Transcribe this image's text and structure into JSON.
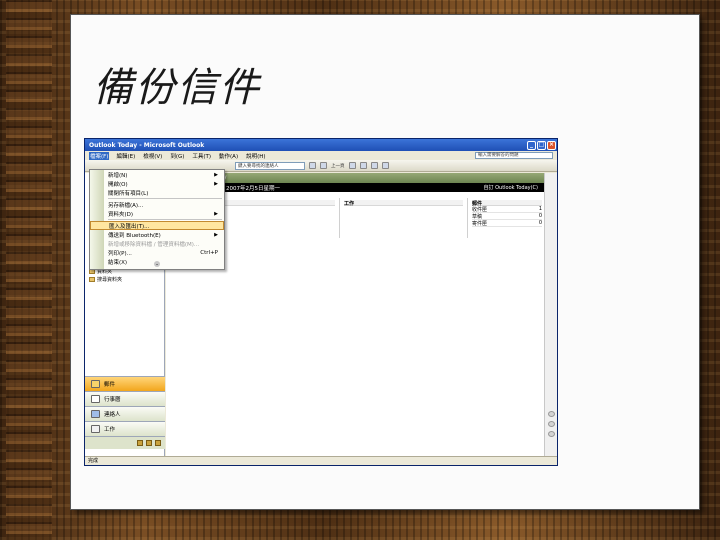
{
  "slide": {
    "title": "備份信件"
  },
  "window": {
    "title": "Outlook Today - Microsoft Outlook",
    "buttons": [
      "_",
      "□",
      "×"
    ]
  },
  "menubar": {
    "items": [
      "檔案(F)",
      "編輯(E)",
      "檢視(V)",
      "到(G)",
      "工具(T)",
      "動作(A)",
      "說明(H)"
    ],
    "help_placeholder": "輸入需要解答的問題"
  },
  "toolbar": {
    "address": "鍵入要尋找的連絡人",
    "back_label": "上一頁",
    "forward_label": ""
  },
  "file_menu": {
    "items": [
      {
        "label": "新增(N)",
        "submenu": true
      },
      {
        "label": "開啟(O)",
        "submenu": true
      },
      {
        "label": "關閉所有項目(L)",
        "submenu": false
      },
      {
        "label": "另存新檔(A)...",
        "submenu": false
      },
      {
        "label": "資料夾(D)",
        "submenu": true
      },
      {
        "label": "匯入及匯出(T)...",
        "submenu": false,
        "highlight": true
      },
      {
        "label": "傳送到 Bluetooth(E)",
        "submenu": true
      },
      {
        "label": "新增或移除資料檔 / 管理資料檔(M)...",
        "submenu": false,
        "disabled": true
      },
      {
        "label": "列印(P)...",
        "shortcut": "Ctrl+P",
        "submenu": false
      },
      {
        "label": "結束(X)",
        "submenu": false
      }
    ]
  },
  "today": {
    "header": "Outlook Today",
    "date": "2007年2月5日星期一",
    "customize": "自訂 Outlook Today(C)",
    "col_calendar": "",
    "col_tasks": "工作",
    "col_mail": "郵件",
    "mail_rows": [
      {
        "name": "收件匣",
        "count": "1"
      },
      {
        "name": "草稿",
        "count": "0"
      },
      {
        "name": "寄件匣",
        "count": "0"
      }
    ]
  },
  "folders": [
    {
      "label": "資料夾"
    },
    {
      "label": "搜尋資料夾"
    }
  ],
  "nav": {
    "buttons": [
      {
        "label": "郵件",
        "icon": "mail-icon",
        "active": true
      },
      {
        "label": "行事曆",
        "icon": "calendar-icon"
      },
      {
        "label": "連絡人",
        "icon": "contacts-icon"
      },
      {
        "label": "工作",
        "icon": "tasks-icon"
      }
    ]
  },
  "status": {
    "text": "完成"
  }
}
